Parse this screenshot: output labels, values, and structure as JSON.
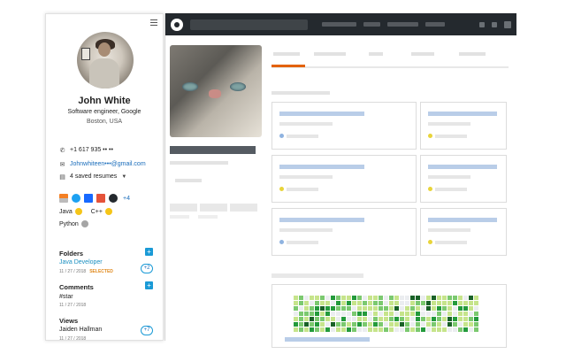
{
  "colors": {
    "accent": "#1a9ad6",
    "link": "#1a6dbb",
    "selected": "#e08a1e",
    "github_nav": "#24292e",
    "github_tab": "#e36209"
  },
  "sidebar": {
    "menu_icon": "hamburger-icon",
    "profile": {
      "name": "John White",
      "title": "Software engineer, Google",
      "location": "Boston, USA"
    },
    "contact": {
      "phone": "+1 617 935 •• ••",
      "email": "Johnwhiteen•••@gmail.com",
      "resumes": "4 saved resumes"
    },
    "social_more": "+4",
    "skills": [
      {
        "name": "Java",
        "badge_color": "#f5c518"
      },
      {
        "name": "C++",
        "badge_color": "#f5c518"
      },
      {
        "name": "Python",
        "badge_color": "#999999"
      }
    ],
    "folders": {
      "title": "Folders",
      "item": "Java Developer",
      "date": "11 / 27 / 2018",
      "selected_label": "SELECTED",
      "count": "+2"
    },
    "comments": {
      "title": "Comments",
      "item": "#star",
      "date": "11 / 27 / 2018"
    },
    "views": {
      "title": "Views",
      "item": "Jaiden Hallman",
      "date": "11 / 27 / 2018",
      "count": "+7"
    }
  },
  "contributions": {
    "colors": [
      "#ebedf0",
      "#c6e48b",
      "#7bc96f",
      "#239a3b",
      "#196127"
    ]
  }
}
